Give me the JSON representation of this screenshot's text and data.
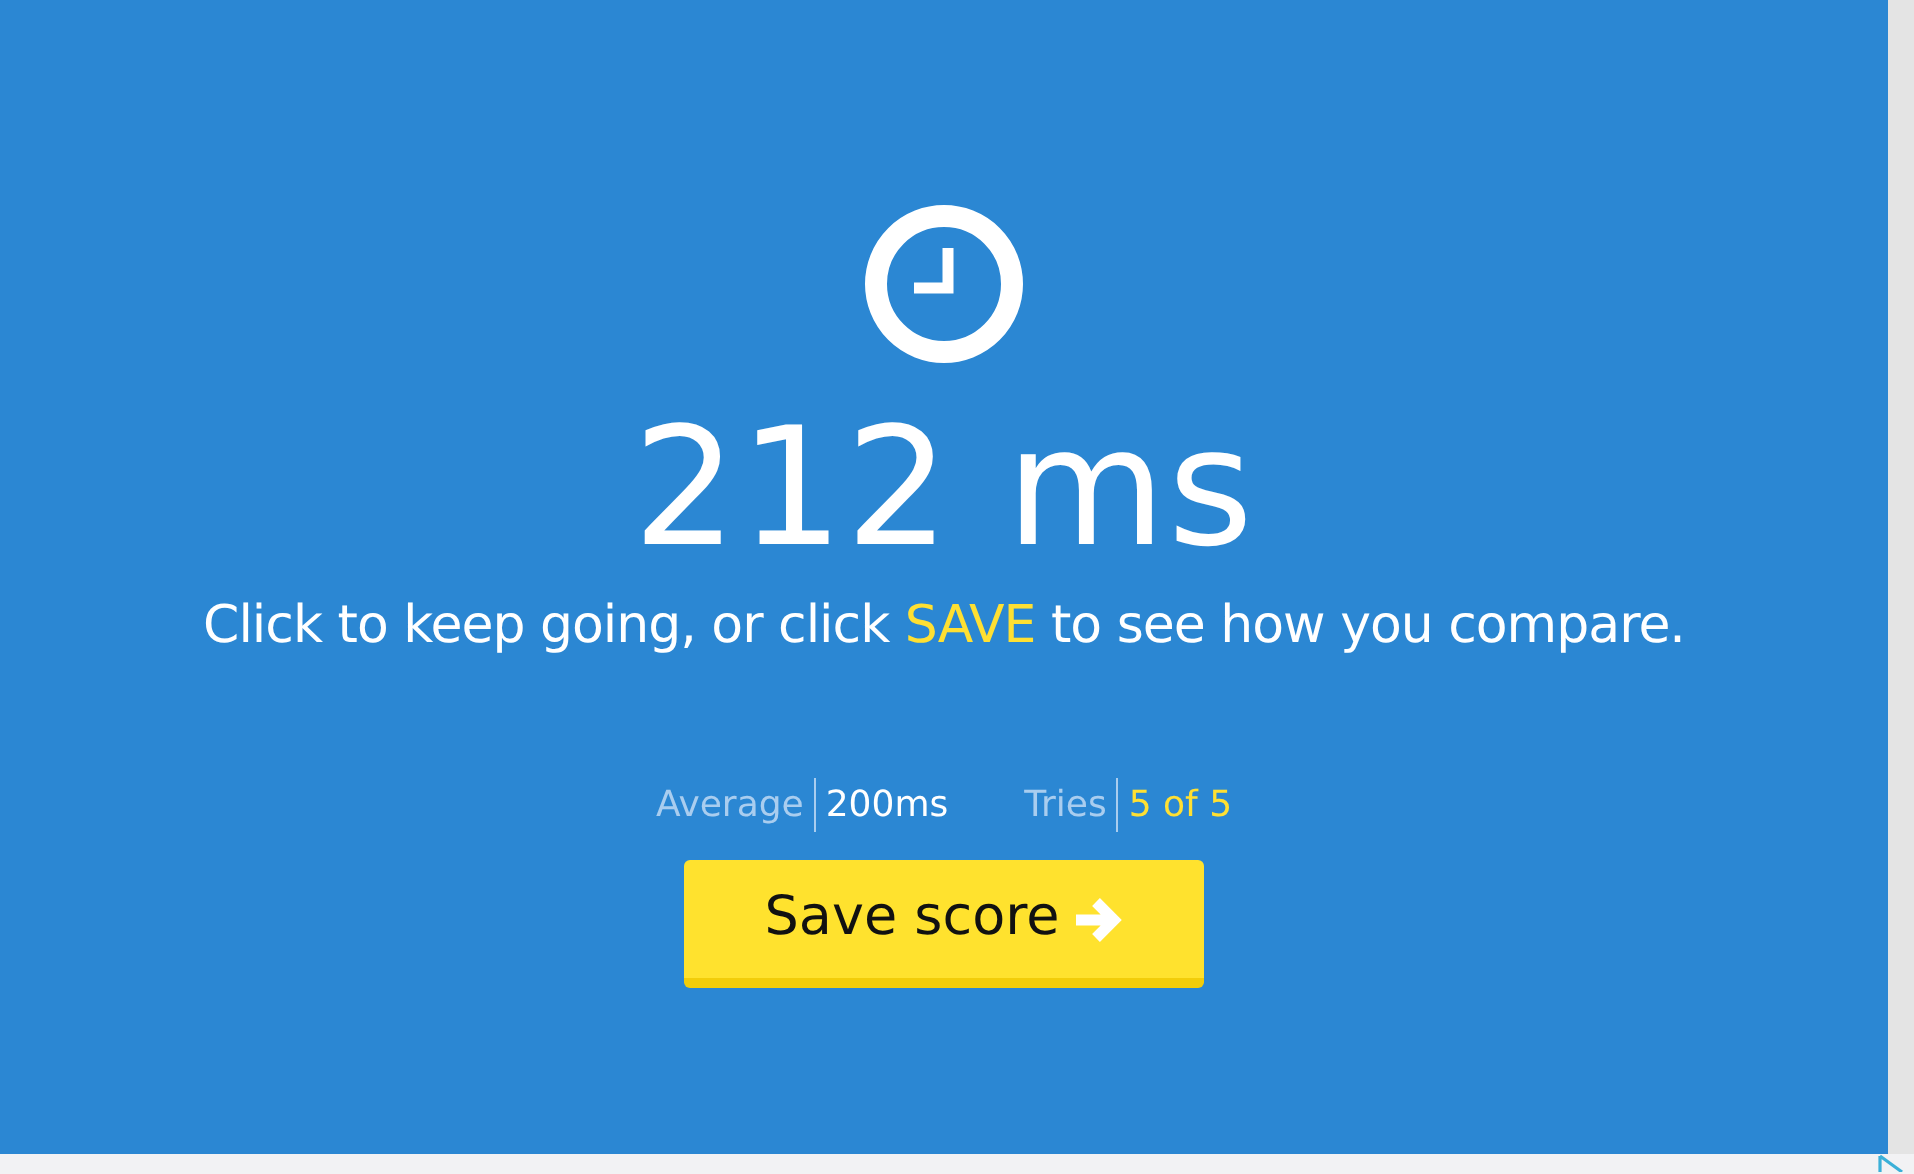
{
  "result": {
    "time": "212 ms",
    "message": [
      {
        "text": "Click to keep going, or click ",
        "highlight": false
      },
      {
        "text": "SAVE",
        "highlight": true
      },
      {
        "text": " to see how you compare.",
        "highlight": false
      }
    ]
  },
  "stats": [
    {
      "label": "Average",
      "value": "200ms",
      "highlight": false
    },
    {
      "label": "Tries",
      "value": "5 of 5",
      "highlight": true
    }
  ],
  "button": {
    "label": "Save score"
  }
}
